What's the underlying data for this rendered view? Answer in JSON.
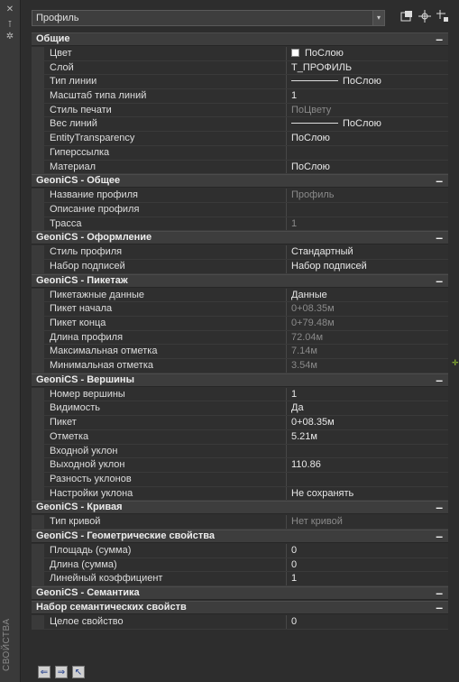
{
  "side": {
    "label": "СВОЙСТВА",
    "buttons": [
      "✕",
      "⊺",
      "✲"
    ]
  },
  "selector": {
    "value": "Профиль",
    "arrow": "▾"
  },
  "toolbar": {
    "icons": [
      "select-objects-icon",
      "quick-select-icon",
      "pickadd-toggle-icon"
    ]
  },
  "sections": [
    {
      "title": "Общие",
      "toggle": "–",
      "rows": [
        {
          "k": "Цвет",
          "v": "ПоСлою",
          "type": "color",
          "ro": false
        },
        {
          "k": "Слой",
          "v": "Т_ПРОФИЛЬ",
          "ro": false
        },
        {
          "k": "Тип линии",
          "v": "ПоСлою",
          "type": "line",
          "ro": false
        },
        {
          "k": "Масштаб типа линий",
          "v": "1",
          "ro": false
        },
        {
          "k": "Стиль печати",
          "v": "ПоЦвету",
          "ro": true
        },
        {
          "k": "Вес линий",
          "v": "ПоСлою",
          "type": "line",
          "ro": false
        },
        {
          "k": "EntityTransparency",
          "v": "ПоСлою",
          "ro": false
        },
        {
          "k": "Гиперссылка",
          "v": "",
          "ro": false
        },
        {
          "k": "Материал",
          "v": "ПоСлою",
          "ro": false
        }
      ]
    },
    {
      "title": "GeoniCS - Общее",
      "toggle": "–",
      "rows": [
        {
          "k": "Название профиля",
          "v": "Профиль",
          "ro": true
        },
        {
          "k": "Описание профиля",
          "v": "",
          "ro": false
        },
        {
          "k": "Трасса",
          "v": "1",
          "ro": true
        }
      ]
    },
    {
      "title": "GeoniCS - Оформление",
      "toggle": "–",
      "rows": [
        {
          "k": "Стиль профиля",
          "v": "Стандартный",
          "ro": false
        },
        {
          "k": "Набор подписей",
          "v": "Набор подписей",
          "ro": false
        }
      ]
    },
    {
      "title": "GeoniCS - Пикетаж",
      "toggle": "–",
      "rows": [
        {
          "k": "Пикетажные данные",
          "v": "Данные",
          "ro": false
        },
        {
          "k": "Пикет начала",
          "v": "0+08.35м",
          "ro": true
        },
        {
          "k": "Пикет конца",
          "v": "0+79.48м",
          "ro": true
        },
        {
          "k": "Длина профиля",
          "v": "72.04м",
          "ro": true
        },
        {
          "k": "Максимальная отметка",
          "v": "7.14м",
          "ro": true
        },
        {
          "k": "Минимальная отметка",
          "v": "3.54м",
          "ro": true
        }
      ]
    },
    {
      "title": "GeoniCS - Вершины",
      "toggle": "–",
      "rows": [
        {
          "k": "Номер вершины",
          "v": "1",
          "ro": false
        },
        {
          "k": "Видимость",
          "v": "Да",
          "ro": false
        },
        {
          "k": "Пикет",
          "v": "0+08.35м",
          "ro": false
        },
        {
          "k": "Отметка",
          "v": "5.21м",
          "ro": false
        },
        {
          "k": "Входной уклон",
          "v": "",
          "ro": false
        },
        {
          "k": "Выходной уклон",
          "v": "110.86",
          "ro": false
        },
        {
          "k": "Разность уклонов",
          "v": "",
          "ro": false
        },
        {
          "k": "Настройки уклона",
          "v": "Не сохранять",
          "ro": false
        }
      ]
    },
    {
      "title": "GeoniCS - Кривая",
      "toggle": "–",
      "rows": [
        {
          "k": "Тип кривой",
          "v": "Нет кривой",
          "ro": true
        }
      ]
    },
    {
      "title": "GeoniCS - Геометрические свойства",
      "toggle": "–",
      "rows": [
        {
          "k": "Площадь (сумма)",
          "v": "0",
          "ro": false
        },
        {
          "k": "Длина (сумма)",
          "v": "0",
          "ro": false
        },
        {
          "k": "Линейный коэффициент",
          "v": "1",
          "ro": false
        }
      ]
    },
    {
      "title": "GeoniCS - Семантика",
      "toggle": "–",
      "rows": []
    },
    {
      "title": "Набор семантических свойств",
      "toggle": "–",
      "rows": [
        {
          "k": "Целое свойство",
          "v": "0",
          "ro": false
        }
      ]
    }
  ],
  "bottom": {
    "icons": [
      "import-icon",
      "export-icon",
      "pointer-icon"
    ]
  }
}
